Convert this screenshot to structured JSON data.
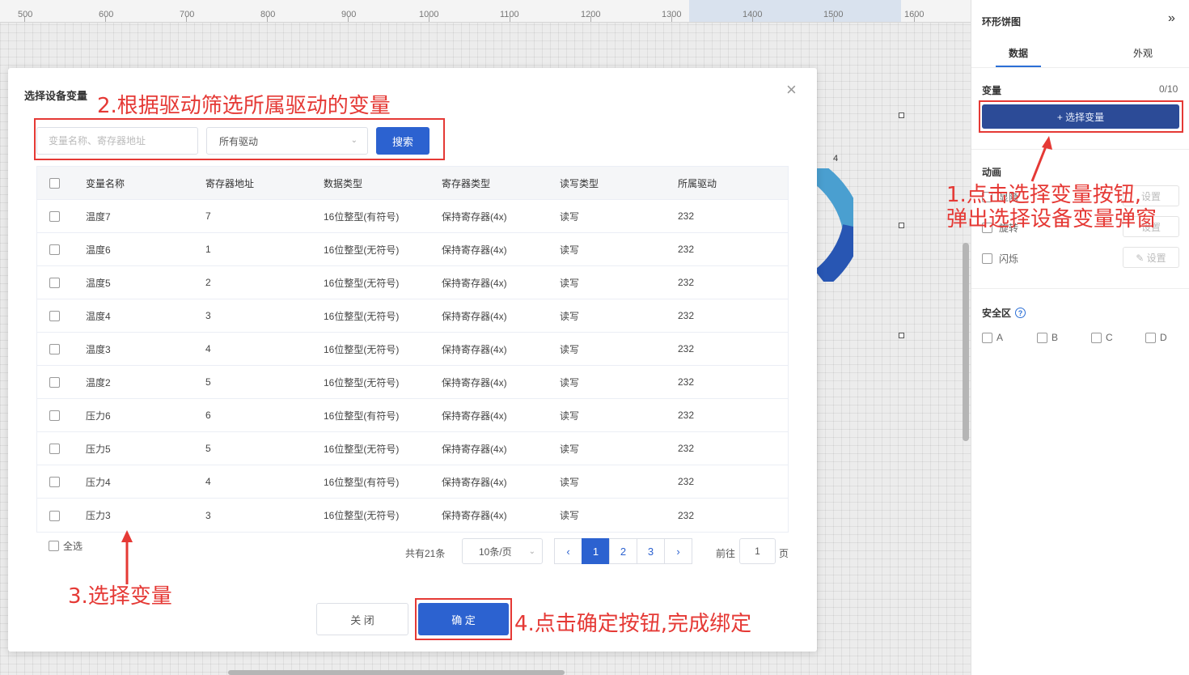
{
  "ruler": {
    "ticks": [
      "500",
      "600",
      "700",
      "800",
      "900",
      "1000",
      "1100",
      "1200",
      "1300",
      "1400",
      "1500",
      "1600"
    ]
  },
  "canvas": {
    "donut_value_label": "4"
  },
  "panel": {
    "title": "环形饼图",
    "collapse_icon": "»",
    "tabs": [
      {
        "label": "数据"
      },
      {
        "label": "外观"
      }
    ],
    "variable": {
      "label": "变量",
      "count": "0/10",
      "select_button": "+ 选择变量"
    },
    "animation": {
      "label": "动画",
      "rows": [
        {
          "label": "显隐",
          "set": "设置"
        },
        {
          "label": "旋转",
          "set": "设置"
        },
        {
          "label": "闪烁",
          "set": "✎ 设置"
        }
      ]
    },
    "safe_zone": {
      "label": "安全区",
      "help": "?",
      "options": [
        "A",
        "B",
        "C",
        "D"
      ]
    }
  },
  "modal": {
    "title": "选择设备变量",
    "close_icon": "×",
    "search_placeholder": "变量名称、寄存器地址",
    "driver_select": "所有驱动",
    "search_button": "搜索",
    "columns": [
      "变量名称",
      "寄存器地址",
      "数据类型",
      "寄存器类型",
      "读写类型",
      "所属驱动"
    ],
    "rows": [
      [
        "温度7",
        "7",
        "16位整型(有符号)",
        "保持寄存器(4x)",
        "读写",
        "232"
      ],
      [
        "温度6",
        "1",
        "16位整型(无符号)",
        "保持寄存器(4x)",
        "读写",
        "232"
      ],
      [
        "温度5",
        "2",
        "16位整型(无符号)",
        "保持寄存器(4x)",
        "读写",
        "232"
      ],
      [
        "温度4",
        "3",
        "16位整型(无符号)",
        "保持寄存器(4x)",
        "读写",
        "232"
      ],
      [
        "温度3",
        "4",
        "16位整型(无符号)",
        "保持寄存器(4x)",
        "读写",
        "232"
      ],
      [
        "温度2",
        "5",
        "16位整型(无符号)",
        "保持寄存器(4x)",
        "读写",
        "232"
      ],
      [
        "压力6",
        "6",
        "16位整型(有符号)",
        "保持寄存器(4x)",
        "读写",
        "232"
      ],
      [
        "压力5",
        "5",
        "16位整型(无符号)",
        "保持寄存器(4x)",
        "读写",
        "232"
      ],
      [
        "压力4",
        "4",
        "16位整型(有符号)",
        "保持寄存器(4x)",
        "读写",
        "232"
      ],
      [
        "压力3",
        "3",
        "16位整型(无符号)",
        "保持寄存器(4x)",
        "读写",
        "232"
      ]
    ],
    "select_all": "全选",
    "total": "共有21条",
    "page_size": "10条/页",
    "pages": [
      "1",
      "2",
      "3"
    ],
    "prev_icon": "‹",
    "next_icon": "›",
    "goto_label": "前往",
    "goto_value": "1",
    "goto_unit": "页",
    "close_button": "关 闭",
    "ok_button": "确 定"
  },
  "annotations": {
    "step1_line1": "1.点击选择变量按钮,",
    "step1_line2": "弹出选择设备变量弹窗",
    "step2": "2.根据驱动筛选所属驱动的变量",
    "step3": "3.选择变量",
    "step4": "4.点击确定按钮,完成绑定"
  },
  "colors": {
    "primary": "#2c62d0",
    "annotation": "#e53935",
    "select_var_btn": "#2c4b97"
  }
}
